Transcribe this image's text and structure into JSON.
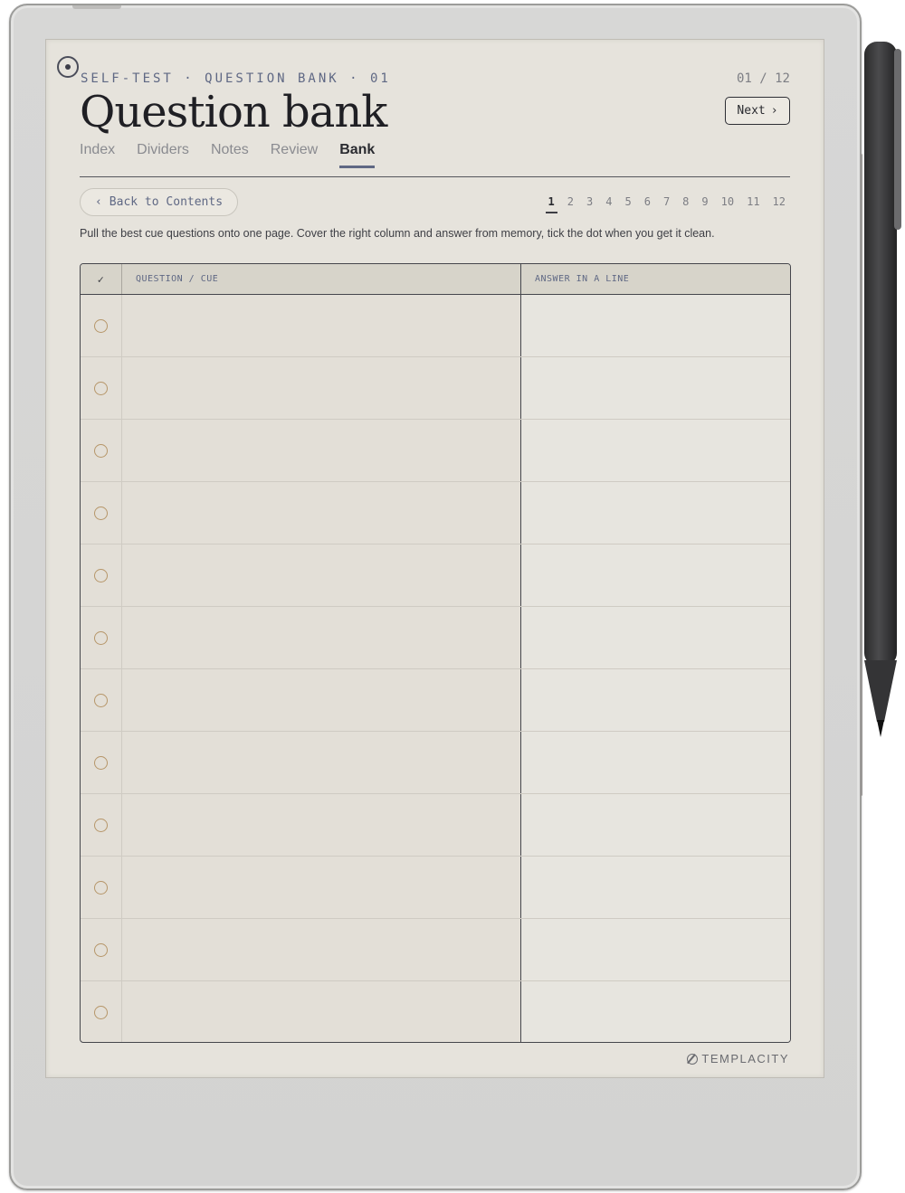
{
  "header": {
    "kicker": "SELF-TEST · QUESTION BANK · 01",
    "page_counter": "01 / 12",
    "title": "Question bank",
    "next_label": "Next",
    "next_glyph": "›"
  },
  "tabs": [
    {
      "label": "Index",
      "active": false
    },
    {
      "label": "Dividers",
      "active": false
    },
    {
      "label": "Notes",
      "active": false
    },
    {
      "label": "Review",
      "active": false
    },
    {
      "label": "Bank",
      "active": true
    }
  ],
  "back_button": {
    "glyph": "‹",
    "label": "Back to Contents"
  },
  "pager": {
    "pages": [
      "1",
      "2",
      "3",
      "4",
      "5",
      "6",
      "7",
      "8",
      "9",
      "10",
      "11",
      "12"
    ],
    "current": "1"
  },
  "instructions": "Pull the best cue questions onto one page. Cover the right column and answer from memory, tick the dot when you get it clean.",
  "table": {
    "col_check": "✓",
    "col_question": "QUESTION / CUE",
    "col_answer": "ANSWER IN A LINE",
    "row_count": 12
  },
  "footer": {
    "brand": "TEMPLACITY"
  },
  "colors": {
    "accent": "#5f6884",
    "tick_dot": "#b69669",
    "ink": "#1f1f24",
    "screen": "#e6e3dc"
  }
}
